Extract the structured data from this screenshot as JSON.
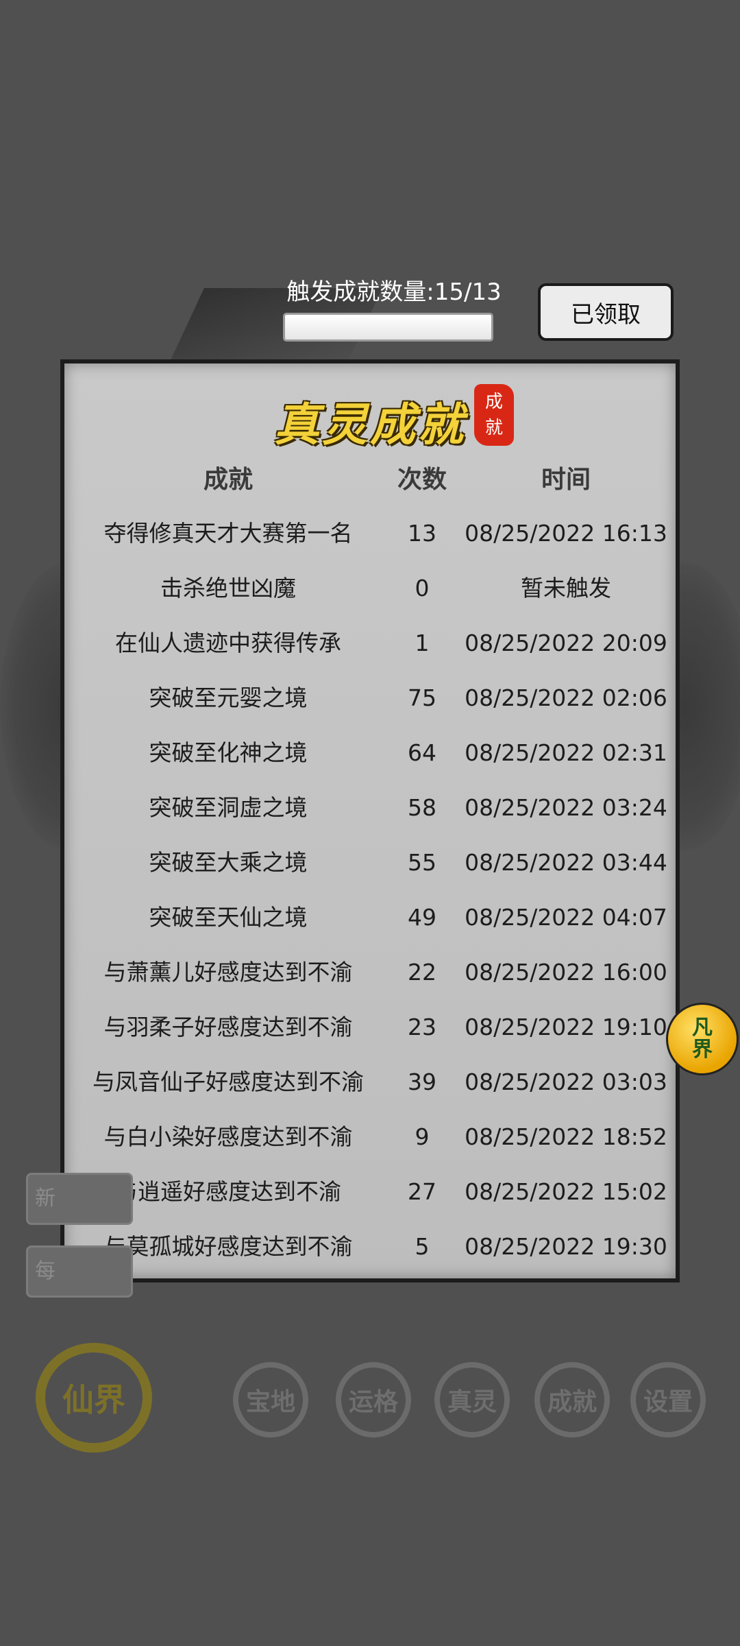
{
  "top_bar": {
    "counter_label": "触发成就数量:15/13",
    "progress": 1.0,
    "claim_button": "已领取"
  },
  "panel": {
    "title": "真灵成就",
    "seal_chars": [
      "成",
      "就"
    ],
    "headers": {
      "name": "成就",
      "count": "次数",
      "time": "时间"
    },
    "rows": [
      {
        "name": "夺得修真天才大赛第一名",
        "count": "13",
        "time": "08/25/2022 16:13"
      },
      {
        "name": "击杀绝世凶魔",
        "count": "0",
        "time": "暂未触发"
      },
      {
        "name": "在仙人遗迹中获得传承",
        "count": "1",
        "time": "08/25/2022 20:09"
      },
      {
        "name": "突破至元婴之境",
        "count": "75",
        "time": "08/25/2022 02:06"
      },
      {
        "name": "突破至化神之境",
        "count": "64",
        "time": "08/25/2022 02:31"
      },
      {
        "name": "突破至洞虚之境",
        "count": "58",
        "time": "08/25/2022 03:24"
      },
      {
        "name": "突破至大乘之境",
        "count": "55",
        "time": "08/25/2022 03:44"
      },
      {
        "name": "突破至天仙之境",
        "count": "49",
        "time": "08/25/2022 04:07"
      },
      {
        "name": "与萧薰儿好感度达到不渝",
        "count": "22",
        "time": "08/25/2022 16:00"
      },
      {
        "name": "与羽柔子好感度达到不渝",
        "count": "23",
        "time": "08/25/2022 19:10"
      },
      {
        "name": "与凤音仙子好感度达到不渝",
        "count": "39",
        "time": "08/25/2022 03:03"
      },
      {
        "name": "与白小染好感度达到不渝",
        "count": "9",
        "time": "08/25/2022 18:52"
      },
      {
        "name": "与逍遥好感度达到不渝",
        "count": "27",
        "time": "08/25/2022 15:02"
      },
      {
        "name": "与莫孤城好感度达到不渝",
        "count": "5",
        "time": "08/25/2022 19:30"
      }
    ]
  },
  "side_buttons": [
    "新",
    "每"
  ],
  "float_button": [
    "凡",
    "界"
  ],
  "bottom_nav": {
    "main": "仙界",
    "items": [
      "宝地",
      "运格",
      "真灵",
      "成就",
      "设置"
    ]
  }
}
